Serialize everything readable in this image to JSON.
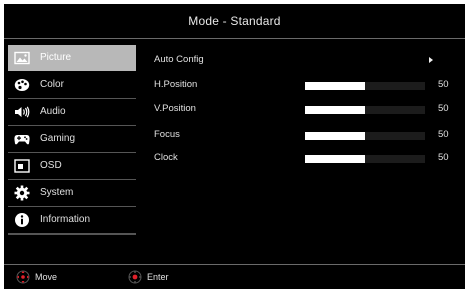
{
  "header": {
    "title": "Mode - Standard"
  },
  "menu": {
    "items": [
      {
        "label": "Picture",
        "icon": "picture-icon",
        "selected": true
      },
      {
        "label": "Color",
        "icon": "palette-icon",
        "selected": false
      },
      {
        "label": "Audio",
        "icon": "speaker-icon",
        "selected": false
      },
      {
        "label": "Gaming",
        "icon": "gamepad-icon",
        "selected": false
      },
      {
        "label": "OSD",
        "icon": "osd-window-icon",
        "selected": false
      },
      {
        "label": "System",
        "icon": "gear-icon",
        "selected": false
      },
      {
        "label": "Information",
        "icon": "info-icon",
        "selected": false
      }
    ]
  },
  "settings": {
    "auto_config": {
      "label": "Auto Config"
    },
    "h_position": {
      "label": "H.Position",
      "value": "50",
      "level": 0.5
    },
    "v_position": {
      "label": "V.Position",
      "value": "50",
      "level": 0.5
    },
    "focus": {
      "label": "Focus",
      "value": "50",
      "level": 0.5
    },
    "clock": {
      "label": "Clock",
      "value": "50",
      "level": 0.5
    }
  },
  "footer": {
    "move": {
      "label": "Move",
      "icon": "joystick-move-icon"
    },
    "enter": {
      "label": "Enter",
      "icon": "joystick-enter-icon"
    }
  },
  "colors": {
    "background": "#000000",
    "selected": "#b8b8b8",
    "slider_fill": "#ffffff",
    "joystick_red": "#e0202a"
  }
}
